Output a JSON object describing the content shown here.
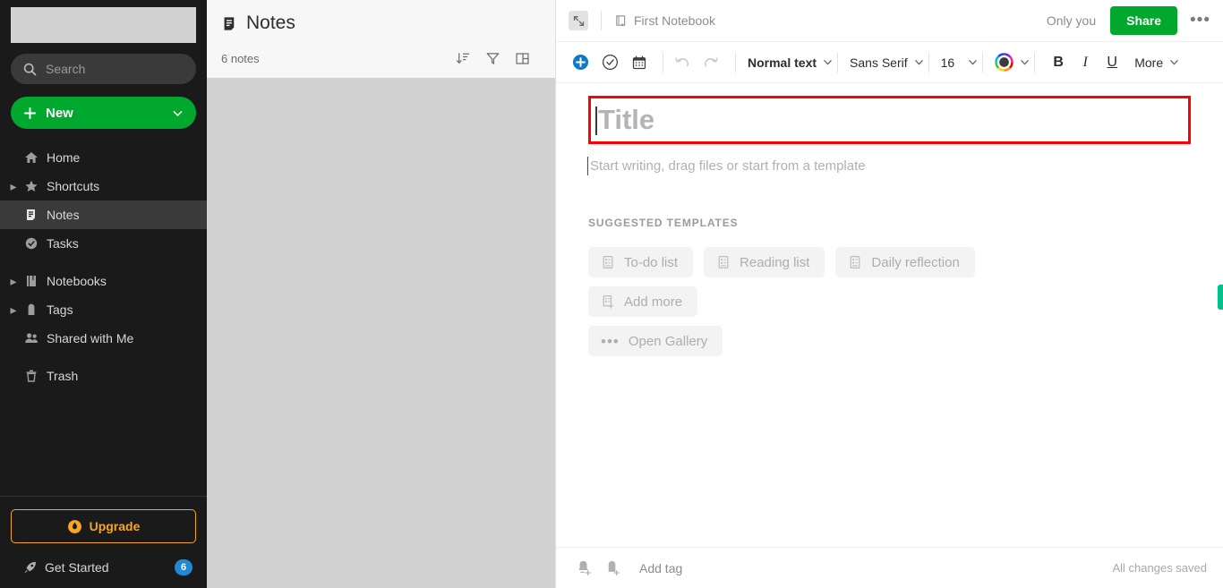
{
  "sidebar": {
    "search": {
      "placeholder": "Search",
      "icon": "search-icon"
    },
    "new_button": {
      "label": "New",
      "icon": "plus-icon",
      "chevron": "chevron-down-icon",
      "color": "#00a82d"
    },
    "items": [
      {
        "label": "Home",
        "icon": "home-icon",
        "caret": false,
        "selected": false
      },
      {
        "label": "Shortcuts",
        "icon": "star-icon",
        "caret": true,
        "selected": false
      },
      {
        "label": "Notes",
        "icon": "note-icon",
        "caret": false,
        "selected": true
      },
      {
        "label": "Tasks",
        "icon": "check-circle-icon",
        "caret": false,
        "selected": false
      },
      {
        "label": "Notebooks",
        "icon": "notebook-icon",
        "caret": true,
        "selected": false
      },
      {
        "label": "Tags",
        "icon": "tag-icon",
        "caret": true,
        "selected": false
      },
      {
        "label": "Shared with Me",
        "icon": "people-icon",
        "caret": false,
        "selected": false
      },
      {
        "label": "Trash",
        "icon": "trash-icon",
        "caret": false,
        "selected": false
      }
    ],
    "upgrade": {
      "label": "Upgrade",
      "icon": "flame-badge-icon",
      "color": "#f5a623"
    },
    "get_started": {
      "label": "Get Started",
      "icon": "rocket-icon",
      "badge": "6",
      "badge_color": "#1e8ad6"
    }
  },
  "notelist": {
    "title": "Notes",
    "title_icon": "note-icon",
    "count": "6 notes",
    "actions": [
      {
        "name": "sort-icon"
      },
      {
        "name": "filter-icon"
      },
      {
        "name": "view-layout-icon"
      }
    ]
  },
  "editor": {
    "topbar": {
      "expand_icon": "expand-collapse-icon",
      "notebook_icon": "notebook-star-icon",
      "notebook_name": "First Notebook",
      "visibility": "Only you",
      "share_label": "Share",
      "share_color": "#00a82d",
      "more_icon": "more-horizontal-icon"
    },
    "toolbar": {
      "insert_icon": "plus-circle-icon",
      "todo_icon": "check-circle-icon",
      "calendar_icon": "calendar-icon",
      "undo_icon": "undo-icon",
      "redo_icon": "redo-icon",
      "paragraph_style": "Normal text",
      "font_family": "Sans Serif",
      "font_size": "16",
      "color_icon": "color-wheel-icon",
      "bold": "B",
      "italic": "I",
      "underline": "U",
      "more_label": "More"
    },
    "title_placeholder": "Title",
    "body_placeholder": "Start writing, drag files or start from a template",
    "templates_heading": "SUGGESTED TEMPLATES",
    "templates_row1": [
      {
        "label": "To-do list",
        "icon": "template-doc-icon"
      },
      {
        "label": "Reading list",
        "icon": "template-doc-icon"
      },
      {
        "label": "Daily reflection",
        "icon": "template-doc-icon"
      }
    ],
    "templates_row2": [
      {
        "label": "Add more",
        "icon": "template-add-icon"
      }
    ],
    "templates_row3": [
      {
        "label": "Open Gallery",
        "icon": "more-horizontal-icon"
      }
    ],
    "bottombar": {
      "reminder_icon": "add-reminder-icon",
      "tag_icon": "add-tag-icon",
      "add_tag_label": "Add tag",
      "save_status": "All changes saved"
    },
    "highlight_color": "#ff0000",
    "side_tab_color": "#00c08b"
  }
}
